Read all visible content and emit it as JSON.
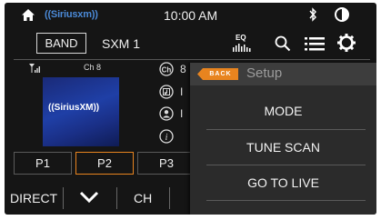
{
  "status": {
    "logo_text": "((Siriusxm))",
    "time": "10:00 AM"
  },
  "toolbar": {
    "band_label": "BAND",
    "station": "SXM 1",
    "eq_label": "EQ"
  },
  "info": {
    "channel": "Ch 8",
    "album_logo": "((SiriusXM))",
    "rows": [
      {
        "icon": "channel-icon",
        "text": "8"
      },
      {
        "icon": "music-note-icon",
        "text": "I"
      },
      {
        "icon": "artist-icon",
        "text": "I"
      },
      {
        "icon": "info-icon",
        "text": ""
      }
    ]
  },
  "presets": [
    "P1",
    "P2",
    "P3"
  ],
  "active_preset": "P2",
  "bottom_bar": {
    "direct_label": "DIRECT",
    "ch_label": "CH"
  },
  "setup_menu": {
    "back_label": "BACK",
    "title": "Setup",
    "items": [
      "MODE",
      "TUNE SCAN",
      "GO TO LIVE"
    ]
  },
  "colors": {
    "accent": "#e8841f",
    "background": "#151515",
    "menu_background": "#2b2b2b",
    "sxm_blue": "#4b8ad8"
  }
}
